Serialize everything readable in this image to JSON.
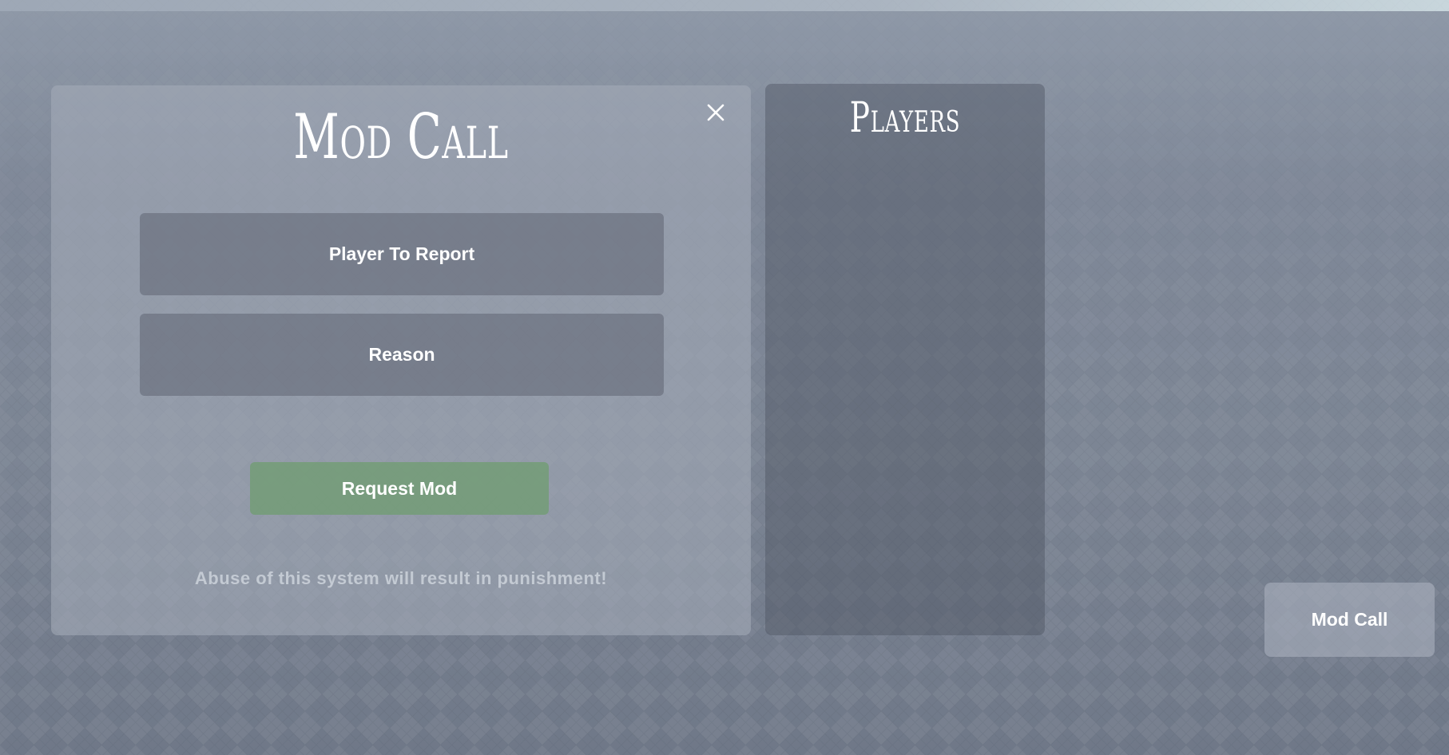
{
  "mod_call_panel": {
    "title": "Mod Call",
    "close_icon": "close-icon",
    "player_field_placeholder": "Player To Report",
    "reason_field_placeholder": "Reason",
    "submit_label": "Request Mod",
    "warning_text": "Abuse of this system will result in punishment!"
  },
  "players_panel": {
    "title": "Players",
    "items": []
  },
  "toggle_button": {
    "label": "Mod Call"
  },
  "colors": {
    "panel_bg": "#a6adba",
    "players_bg": "#4e5462",
    "field_bg": "#626875",
    "submit_bg": "#6e9c6e",
    "text": "#ffffff",
    "warning_text": "#cdd2da"
  }
}
